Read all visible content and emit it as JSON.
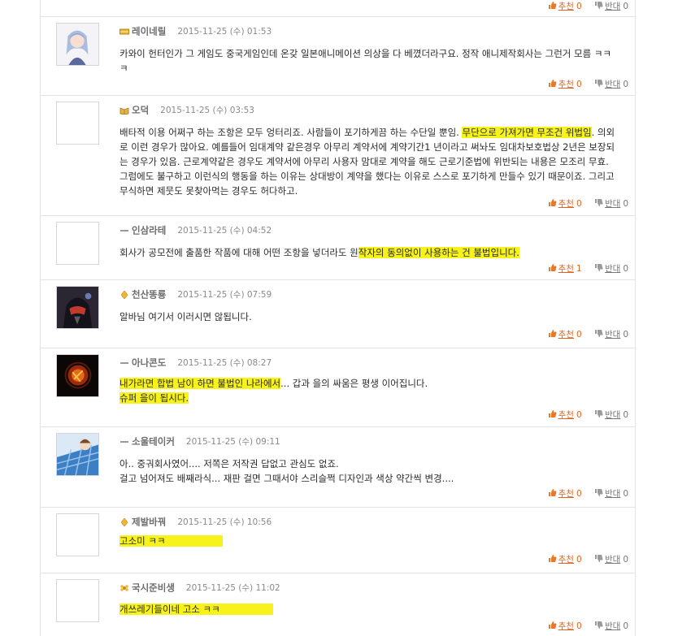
{
  "vote_labels": {
    "up": "추천",
    "down": "반대"
  },
  "top_votes": {
    "up_count": "0",
    "down_count": "0"
  },
  "comments": [
    {
      "author": "레이네릴",
      "date": "2015-11-25 (수) 01:53",
      "lines": [
        "카와이 헌터인가 그 게임도 중국게임인데 온갖 일본애니메이션 의상을 다 베꼈더라구요. 정작 애니제작회사는 그런거 모름 ㅋㅋ",
        "ㅋ"
      ],
      "up": "0",
      "down": "0",
      "avatar": "anime-girl-avatar",
      "level_icon": "gold-bar-icon"
    },
    {
      "author": "오덕",
      "date": "2015-11-25 (수) 03:53",
      "lines_a": [
        "배타적 이용 어쩌구 하는 조항은 모두 엉터리죠. 사람들이 포기하게끔 하는 수단일 뿐임. ",
        "무단으로 가져가면 무조건 위법임",
        ". 의외"
      ],
      "lines": [
        "로 이런 경우가 많아요. 예를들어 임대계약 같은경우 아무리 계약서에 계약기간1 년이라고 써놔도 임대차보호법상 2년은 보장되",
        "는 경우가 있음. 근로계약같은 경우도 계약서에 아무리 사용자 맘대로 계약을 해도 근로기준법에 위반되는 내용은 모조리 무효.",
        "그럼에도 불구하고 이런식의 행동을 하는 이유는 상대방이 계약을 했다는 이유로 스스로 포기하게 만들수 있기 때문이죠. 그리고",
        "무식하면 제뭇도 못찾아먹는 경우도 허다하고."
      ],
      "up": "0",
      "down": "0",
      "avatar": "blank-avatar",
      "level_icon": "book-icon"
    },
    {
      "author": "인삼라테",
      "date": "2015-11-25 (수) 04:52",
      "text_plain": "회사가 공모전에 출품한 작품에 대해 어떤 조항을 넣더라도 원",
      "text_hl": "작자의 동의없이 사용하는 건 불법입니다.",
      "up": "1",
      "down": "0",
      "avatar": "blank-avatar",
      "level_icon": "dash-icon"
    },
    {
      "author": "천산똥룡",
      "date": "2015-11-25 (수) 07:59",
      "lines": [
        "알바님 여기서 이러시면 않됩니다."
      ],
      "up": "0",
      "down": "0",
      "avatar": "dark-helmet-avatar",
      "level_icon": "diamond-icon"
    },
    {
      "author": "아나콘도",
      "date": "2015-11-25 (수) 08:27",
      "line1_hl": "내가라면 합법 남이 하면 불법인 나라에서",
      "line1_plain": "... 갑과 을의 싸움은 평생 이어집니다.",
      "line2_hl": "슈퍼 을이 됩시다.",
      "up": "0",
      "down": "0",
      "avatar": "fire-orb-avatar",
      "level_icon": "dash-icon"
    },
    {
      "author": "소울테이커",
      "date": "2015-11-25 (수) 09:11",
      "lines": [
        "아.. 중궈회사였어.... 저쪽은 저작권 답없고 관심도 없죠.",
        "걸고 넘어져도 배째라식... 재판 걸면 그때서야 스리슬쩍 디자인과 색상 약간씩 변경...."
      ],
      "up": "0",
      "down": "0",
      "avatar": "anime-blue-avatar",
      "level_icon": "dash-icon"
    },
    {
      "author": "제발바꿔",
      "date": "2015-11-25 (수) 10:56",
      "text_hl": "고소미 ㅋㅋ",
      "up": "0",
      "down": "0",
      "avatar": "blank-avatar",
      "level_icon": "diamond-icon"
    },
    {
      "author": "국시준비생",
      "date": "2015-11-25 (수) 11:02",
      "text_hl": "개쓰레기들이네 고소 ㅋㅋ",
      "up": "0",
      "down": "0",
      "avatar": "blank-avatar",
      "level_icon": "flower-icon"
    }
  ]
}
